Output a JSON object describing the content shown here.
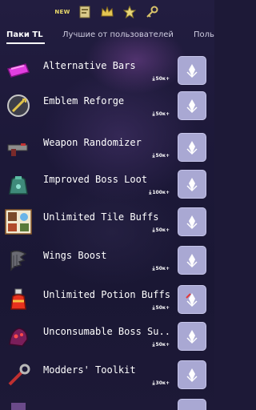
{
  "topbar": {
    "new_badge": "NEW",
    "icons": [
      "new-badge",
      "book-icon",
      "crown-icon",
      "star-icon",
      "key-icon"
    ]
  },
  "tabs": [
    {
      "label": "Паки TL",
      "active": true
    },
    {
      "label": "Лучшие от пользователей",
      "active": false
    },
    {
      "label": "Поль",
      "active": false
    }
  ],
  "mods": [
    {
      "name": "Alternative Bars",
      "downloads": "50к+",
      "icon": "magenta-bar-icon"
    },
    {
      "name": "Emblem Reforge",
      "downloads": "50к+",
      "icon": "emblem-icon"
    },
    {
      "name": "Weapon Randomizer",
      "downloads": "50к+",
      "icon": "gun-icon"
    },
    {
      "name": "Improved Boss Loot",
      "downloads": "100к+",
      "icon": "treasure-bag-icon"
    },
    {
      "name": "Unlimited Tile Buffs",
      "downloads": "50к+",
      "icon": "tile-buffs-icon"
    },
    {
      "name": "Wings Boost",
      "downloads": "50к+",
      "icon": "wings-icon"
    },
    {
      "name": "Unlimited Potion Buffs",
      "downloads": "50к+",
      "icon": "potion-icon"
    },
    {
      "name": "Unconsumable Boss Su...",
      "downloads": "50к+",
      "icon": "boss-summon-icon"
    },
    {
      "name": "Modders' Toolkit",
      "downloads": "30к+",
      "icon": "wrench-icon"
    },
    {
      "name": "",
      "downloads": "",
      "icon": "partial-icon"
    }
  ],
  "colors": {
    "background": "#1d1937",
    "button": "#a9a8d3",
    "text": "#ffffff"
  }
}
